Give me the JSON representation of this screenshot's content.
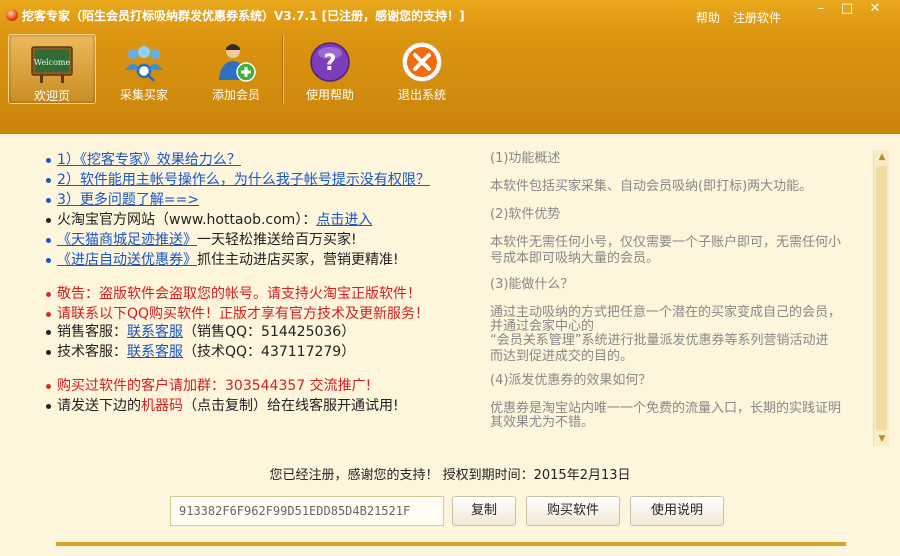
{
  "window": {
    "title": "挖客专家（陌生会员打标吸纳群发优惠券系统）V3.7.1 [已注册，感谢您的支持！]",
    "links": {
      "help": "帮助",
      "register": "注册软件"
    },
    "controls": {
      "minimize": "–",
      "maximize": "□",
      "close": "✕"
    }
  },
  "toolbar": {
    "items": [
      {
        "label": "欢迎页",
        "icon": "chalkboard-icon",
        "active": true
      },
      {
        "label": "采集买家",
        "icon": "users-search-icon",
        "active": false
      },
      {
        "label": "添加会员",
        "icon": "add-user-icon",
        "active": false
      },
      {
        "label": "使用帮助",
        "icon": "help-icon",
        "active": false
      },
      {
        "label": "退出系统",
        "icon": "exit-icon",
        "active": false
      }
    ],
    "chalkboard_text": "Welcome"
  },
  "left": {
    "lines": [
      {
        "link1": "1）《挖客专家》效果给力么？"
      },
      {
        "link1": "2）软件能用主帐号操作么，为什么我子帐号提示没有权限？"
      },
      {
        "link1": "3）更多问题了解==>"
      },
      {
        "text1": "火淘宝官方网站（www.hottaob.com）：",
        "link1": "点击进入"
      },
      {
        "link1": "《天猫商城足迹推送》",
        "text1": "一天轻松推送给百万买家!"
      },
      {
        "link1": "《进店自动送优惠券》",
        "text1": "抓住主动进店买家，营销更精准!"
      },
      {
        "red1": "敬告：盗版软件会盗取您的帐号。请支持火淘宝正版软件！"
      },
      {
        "red1": "请联系以下QQ购买软件！正版才享有官方技术及更新服务！"
      },
      {
        "text1": "销售客服：",
        "link1": "联系客服",
        "text2": "（销售QQ：",
        "red1": "514425036",
        "text3": "）"
      },
      {
        "text1": "技术客服：",
        "link1": "联系客服",
        "text2": "（技术QQ：",
        "red1": "437117279",
        "text3": "）"
      },
      {
        "red1": "购买过软件的客户请加群：",
        "red2": "303544357",
        "red3": " 交流推广!"
      },
      {
        "text1": "请发送下边的",
        "red1": "机器码",
        "text2": "（点击复制）给在线客服开通试用!"
      }
    ]
  },
  "right": {
    "lines": [
      "(1)功能概述",
      "本软件包括买家采集、自动会员吸纳(即打标)两大功能。",
      "(2)软件优势",
      "本软件无需任何小号，仅仅需要一个子账户即可，无需任何小",
      "号成本即可吸纳大量的会员。",
      "(3)能做什么？",
      "通过主动吸纳的方式把任意一个潜在的买家变成自己的会员，",
      "并通过会家中心的",
      "“会员关系管理”系统进行批量派发优惠券等系列营销活动进",
      "而达到促进成交的目的。",
      "(4)派发优惠券的效果如何？",
      "优惠券是淘宝站内唯一一个免费的流量入口，长期的实践证明",
      "其效果尤为不错。"
    ],
    "scroll_up": "▲",
    "scroll_down": "▼"
  },
  "bottom": {
    "status": "您已经注册，感谢您的支持！  授权到期时间：2015年2月13日",
    "machine_code": "913382F6F962F99D51EDD85D4B21521F",
    "copy_label": "复制",
    "buy_label": "购买软件",
    "manual_label": "使用说明"
  }
}
